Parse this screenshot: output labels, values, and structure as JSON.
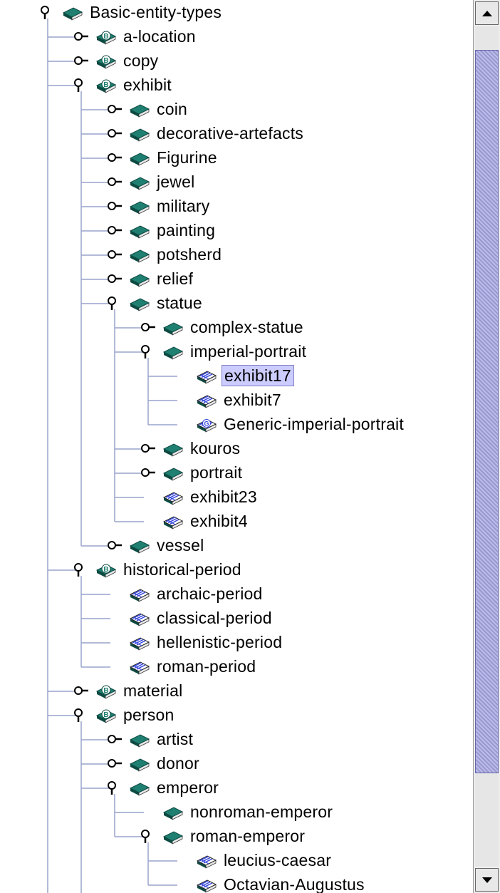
{
  "tree": {
    "nodes": [
      {
        "label": "Basic-entity-types",
        "depth": 0,
        "type": "class",
        "expanded": true
      },
      {
        "label": "a-location",
        "depth": 1,
        "type": "basic",
        "expanded": false
      },
      {
        "label": "copy",
        "depth": 1,
        "type": "basic",
        "expanded": false
      },
      {
        "label": "exhibit",
        "depth": 1,
        "type": "basic",
        "expanded": true
      },
      {
        "label": "coin",
        "depth": 2,
        "type": "class",
        "expanded": false
      },
      {
        "label": "decorative-artefacts",
        "depth": 2,
        "type": "class",
        "expanded": false
      },
      {
        "label": "Figurine",
        "depth": 2,
        "type": "class",
        "expanded": false
      },
      {
        "label": "jewel",
        "depth": 2,
        "type": "class",
        "expanded": false
      },
      {
        "label": "military",
        "depth": 2,
        "type": "class",
        "expanded": false
      },
      {
        "label": "painting",
        "depth": 2,
        "type": "class",
        "expanded": false
      },
      {
        "label": "potsherd",
        "depth": 2,
        "type": "class",
        "expanded": false
      },
      {
        "label": "relief",
        "depth": 2,
        "type": "class",
        "expanded": false
      },
      {
        "label": "statue",
        "depth": 2,
        "type": "class",
        "expanded": true
      },
      {
        "label": "complex-statue",
        "depth": 3,
        "type": "class",
        "expanded": false
      },
      {
        "label": "imperial-portrait",
        "depth": 3,
        "type": "class",
        "expanded": true
      },
      {
        "label": "exhibit17",
        "depth": 4,
        "type": "instance",
        "selected": true
      },
      {
        "label": "exhibit7",
        "depth": 4,
        "type": "instance"
      },
      {
        "label": "Generic-imperial-portrait",
        "depth": 4,
        "type": "generic"
      },
      {
        "label": "kouros",
        "depth": 3,
        "type": "class",
        "expanded": false
      },
      {
        "label": "portrait",
        "depth": 3,
        "type": "class",
        "expanded": false
      },
      {
        "label": "exhibit23",
        "depth": 3,
        "type": "instance"
      },
      {
        "label": "exhibit4",
        "depth": 3,
        "type": "instance"
      },
      {
        "label": "vessel",
        "depth": 2,
        "type": "class",
        "expanded": false
      },
      {
        "label": "historical-period",
        "depth": 1,
        "type": "basic",
        "expanded": true
      },
      {
        "label": "archaic-period",
        "depth": 2,
        "type": "instance"
      },
      {
        "label": "classical-period",
        "depth": 2,
        "type": "instance"
      },
      {
        "label": "hellenistic-period",
        "depth": 2,
        "type": "instance"
      },
      {
        "label": "roman-period",
        "depth": 2,
        "type": "instance"
      },
      {
        "label": "material",
        "depth": 1,
        "type": "basic",
        "expanded": false
      },
      {
        "label": "person",
        "depth": 1,
        "type": "basic",
        "expanded": true
      },
      {
        "label": "artist",
        "depth": 2,
        "type": "class",
        "expanded": false
      },
      {
        "label": "donor",
        "depth": 2,
        "type": "class",
        "expanded": false
      },
      {
        "label": "emperor",
        "depth": 2,
        "type": "class",
        "expanded": true
      },
      {
        "label": "nonroman-emperor",
        "depth": 3,
        "type": "class"
      },
      {
        "label": "roman-emperor",
        "depth": 3,
        "type": "class",
        "expanded": true
      },
      {
        "label": "leucius-caesar",
        "depth": 4,
        "type": "instance"
      },
      {
        "label": "Octavian-Augustus",
        "depth": 4,
        "type": "instance"
      }
    ],
    "continuing_depths": [
      0,
      1
    ]
  },
  "icons": {
    "class": "book-icon",
    "basic": "basic-type-book-icon",
    "instance": "instance-book-icon",
    "generic": "generic-instance-book-icon",
    "expanded_handle": "expanded-handle-icon",
    "collapsed_handle": "collapsed-handle-icon"
  },
  "colors": {
    "book_cover": "#1f7f70",
    "book_dark": "#0d4a42",
    "instance_blue": "#3344dd",
    "tree_lines": "#99a3cc",
    "selection": "#ccccff",
    "scroll_thumb": "#aaaadd"
  },
  "scrollbar": {
    "up_icon": "arrow-up-icon",
    "down_icon": "arrow-down-icon",
    "thumb_fraction": 0.86
  }
}
